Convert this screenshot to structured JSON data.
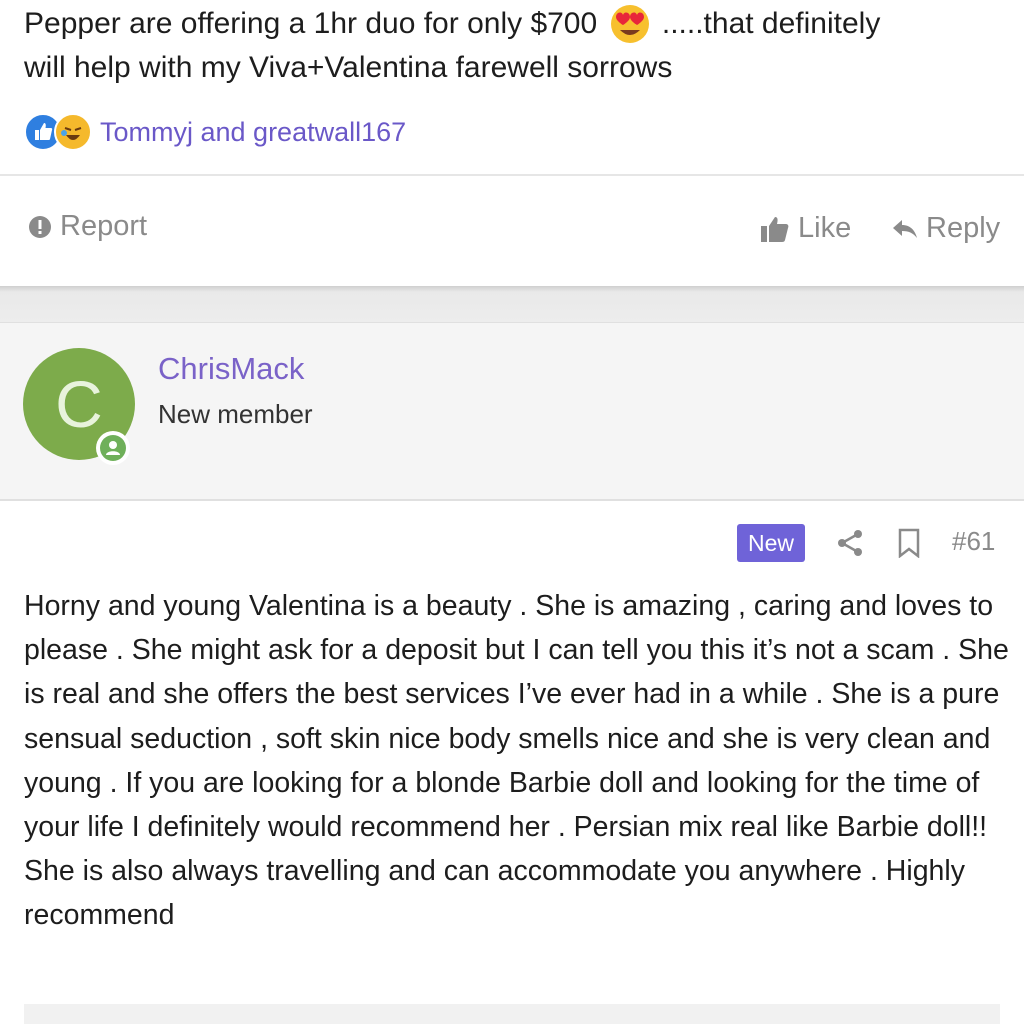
{
  "post": {
    "text_line1": "Pepper are offering a 1hr duo for only $700",
    "emoji": "heart-eyes-emoji",
    "text_line1_end": ".....that definitely",
    "text_line2": "will help with my Viva+Valentina farewell sorrows",
    "reaction_users": "Tommyj and greatwall167"
  },
  "actions": {
    "report": "Report",
    "like": "Like",
    "reply": "Reply"
  },
  "author": {
    "initial": "C",
    "name": "ChrisMack",
    "title": "New member",
    "avatar_color": "#7dab4b"
  },
  "meta": {
    "badge": "New",
    "post_number": "#61"
  },
  "body": {
    "text": "Horny and young Valentina is a beauty . She is amazing , caring and loves to please . She might ask for a deposit but I can tell you this it’s not a scam . She is real and she offers the best services I’ve ever had in a while . She is a pure sensual seduction , soft skin nice body smells nice and she is very clean and young . If you are looking for a blonde Barbie doll and looking for the time of your life I definitely would recommend her . Persian mix real like Barbie doll!! She is also always travelling and can accommodate you anywhere . Highly recommend"
  },
  "colors": {
    "accent": "#6f63d8",
    "link": "#7a62c8",
    "muted": "#8a8a8a"
  }
}
